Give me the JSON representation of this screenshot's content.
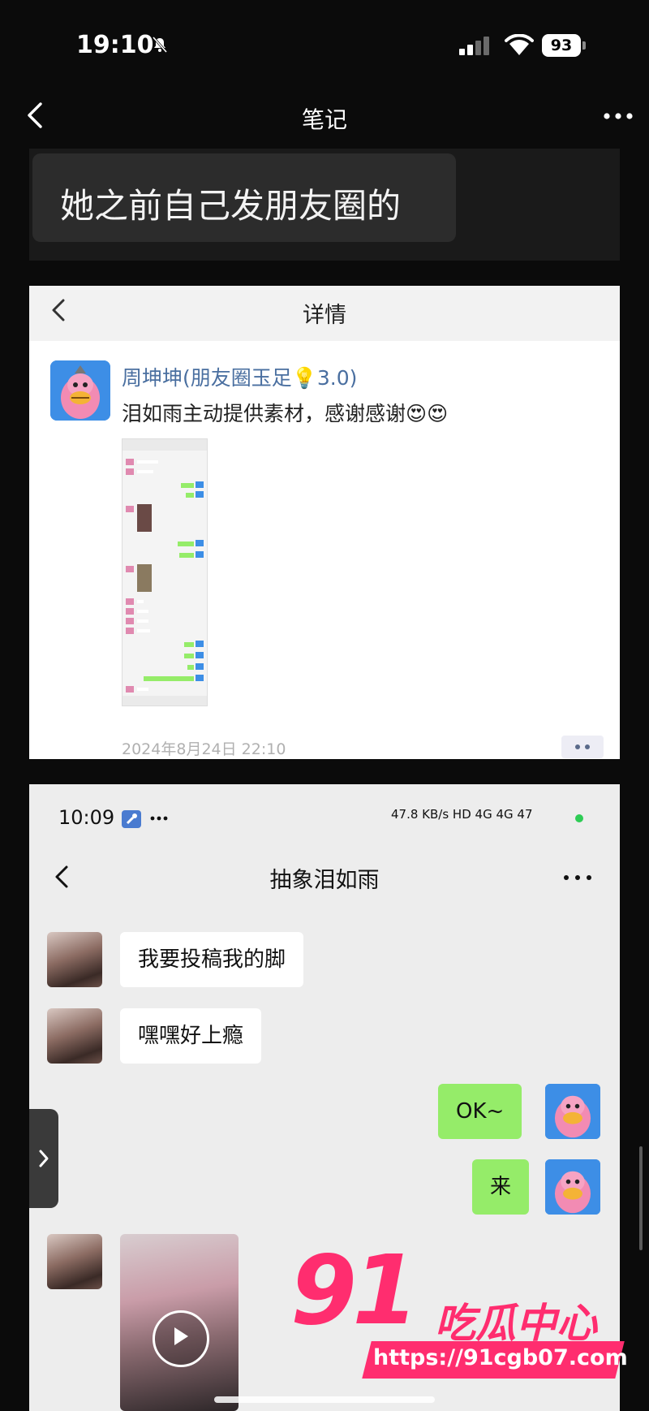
{
  "status_bar": {
    "time": "19:10",
    "battery": "93"
  },
  "nav": {
    "title": "笔记"
  },
  "note": {
    "text": "她之前自己发朋友圈的"
  },
  "detail_card": {
    "title": "详情",
    "author": "周坤坤(朋友圈玉足💡3.0)",
    "post_text": "泪如雨主动提供素材，感谢感谢😍😍",
    "date": "2024年8月24日 22:10"
  },
  "chat_card": {
    "status_time": "10:09",
    "status_icons": "47.8 KB/s HD 4G 4G 47",
    "title": "抽象泪如雨",
    "messages": [
      {
        "side": "left",
        "text": "我要投稿我的脚"
      },
      {
        "side": "left",
        "text": "嘿嘿好上瘾"
      },
      {
        "side": "right",
        "text": "OK~"
      },
      {
        "side": "right",
        "text": "来"
      }
    ]
  },
  "watermark": {
    "number": "91",
    "name": "吃瓜中心",
    "url": "https://91cgb07.com"
  },
  "colors": {
    "accent": "#ff2d6f",
    "bubble_green": "#95ec69",
    "link_blue": "#4a6fa0"
  }
}
